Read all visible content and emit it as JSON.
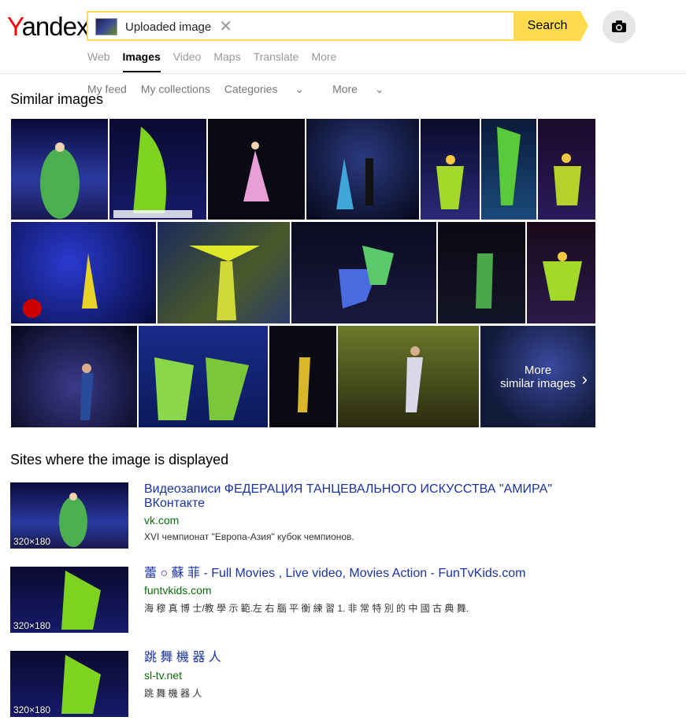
{
  "header": {
    "logo_y": "Y",
    "logo_rest": "andex",
    "chip_label": "Uploaded image",
    "search_label": "Search"
  },
  "tabs": [
    "Web",
    "Images",
    "Video",
    "Maps",
    "Translate",
    "More"
  ],
  "subnav": [
    "My feed",
    "My collections",
    "Categories",
    "More"
  ],
  "similar": {
    "heading": "Similar images",
    "more_line1": "More",
    "more_line2": "similar images"
  },
  "sites": {
    "heading": "Sites where the image is displayed",
    "items": [
      {
        "title": "Видеозаписи ФЕДЕРАЦИЯ ТАНЦЕВАЛЬНОГО ИСКУССТВА \"АМИРА\" ВКонтакте",
        "url": "vk.com",
        "desc": "XVI чемпионат \"Европа-Азия\" кубок чемпионов.",
        "dims": "320×180"
      },
      {
        "title": "蕾 ○ 蘇 菲 - Full Movies , Live video, Movies Action - FunTvKids.com",
        "url": "funtvkids.com",
        "desc": "海 穆 真 博 士/教 學 示 範.左 右 腦 平 衡 練 習 1. 非 常 特 別 的 中 國 古 典 舞.",
        "dims": "320×180"
      },
      {
        "title": "跳 舞 機 器 人",
        "url": "sl-tv.net",
        "desc": "跳 舞 機 器 人",
        "dims": "320×180"
      }
    ]
  },
  "colors": {
    "accent": "#ffdb4d",
    "link": "#1a33a3",
    "url": "#0a6b0a"
  }
}
